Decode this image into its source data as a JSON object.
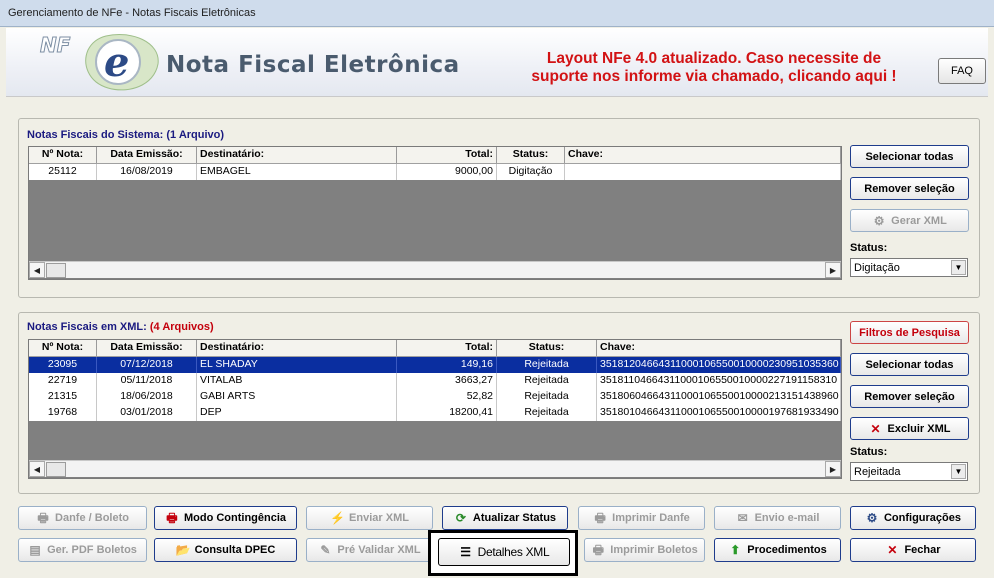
{
  "window": {
    "title": "Gerenciamento de NFe - Notas Fiscais Eletrônicas"
  },
  "banner": {
    "logo_text": "NFe",
    "brand": "Nota Fiscal Eletrônica",
    "notice_line1": "Layout NFe 4.0 atualizado. Caso necessite de",
    "notice_line2": "suporte nos informe via chamado, clicando aqui !",
    "faq_label": "FAQ"
  },
  "system_notes": {
    "title": "Notas Fiscais do Sistema:",
    "count": "(1 Arquivo)",
    "columns": [
      "Nº Nota:",
      "Data Emissão:",
      "Destinatário:",
      "Total:",
      "Status:",
      "Chave:"
    ],
    "rows": [
      [
        "25112",
        "16/08/2019",
        "EMBAGEL",
        "9000,00",
        "Digitação",
        ""
      ]
    ],
    "buttons": {
      "select_all": "Selecionar todas",
      "remove_selection": "Remover seleção",
      "generate_xml": "Gerar XML"
    },
    "status_label": "Status:",
    "status_value": "Digitação"
  },
  "xml_notes": {
    "title": "Notas Fiscais em XML:",
    "count": "(4 Arquivos)",
    "columns": [
      "Nº Nota:",
      "Data Emissão:",
      "Destinatário:",
      "Total:",
      "Status:",
      "Chave:"
    ],
    "rows": [
      [
        "23095",
        "07/12/2018",
        "EL SHADAY",
        "149,16",
        "Rejeitada",
        "35181204664311000106550010000230951035360"
      ],
      [
        "22719",
        "05/11/2018",
        "VITALAB",
        "3663,27",
        "Rejeitada",
        "35181104664311000106550010000227191158310"
      ],
      [
        "21315",
        "18/06/2018",
        "GABI ARTS",
        "52,82",
        "Rejeitada",
        "35180604664311000106550010000213151438960"
      ],
      [
        "19768",
        "03/01/2018",
        "DEP",
        "18200,41",
        "Rejeitada",
        "35180104664311000106550010000197681933490"
      ]
    ],
    "buttons": {
      "filters": "Filtros de Pesquisa",
      "select_all": "Selecionar todas",
      "remove_selection": "Remover seleção",
      "delete_xml": "Excluir XML"
    },
    "status_label": "Status:",
    "status_value": "Rejeitada"
  },
  "actions": {
    "danfe_boleto": "Danfe / Boleto",
    "contingency": "Modo Contingência",
    "send_xml": "Enviar XML",
    "update_status": "Atualizar Status",
    "print_danfe": "Imprimir Danfe",
    "send_email": "Envio e-mail",
    "settings": "Configurações",
    "pdf_boletos": "Ger. PDF Boletos",
    "dpec": "Consulta DPEC",
    "prevalidate_xml": "Pré Validar XML",
    "xml_details": "Detalhes XML",
    "print_boletos": "Imprimir Boletos",
    "procedures": "Procedimentos",
    "close": "Fechar"
  },
  "colors": {
    "selection": "#0a2ea0",
    "notice": "#d21214",
    "group_title": "#1a1a80"
  }
}
